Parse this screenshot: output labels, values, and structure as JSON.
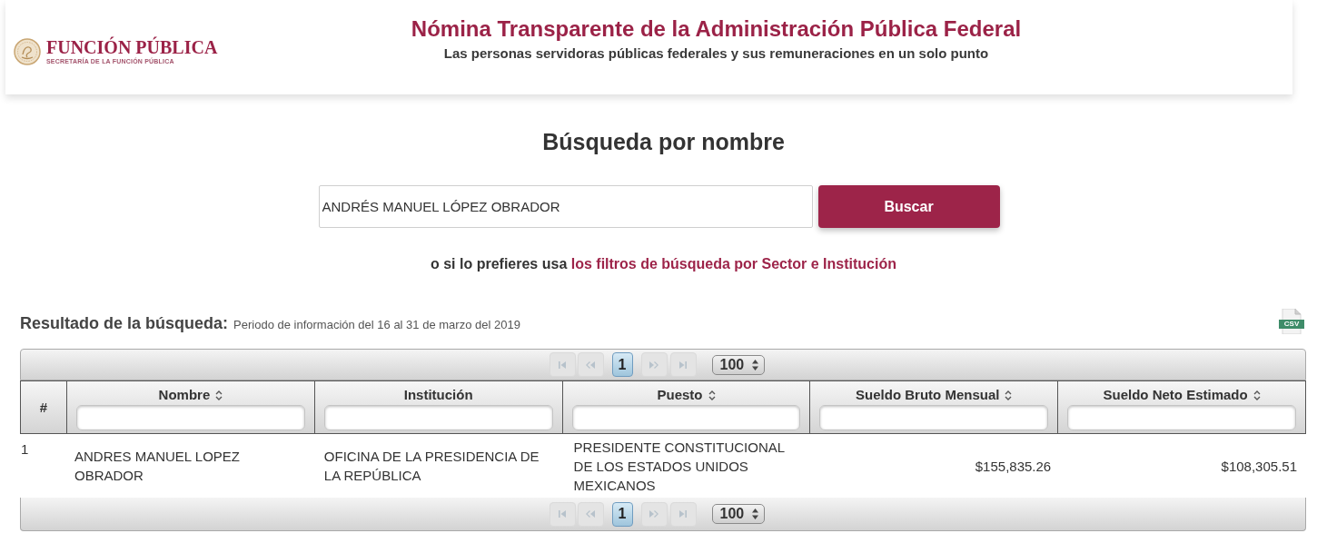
{
  "header": {
    "logo_name": "FUNCIÓN PÚBLICA",
    "logo_tagline": "SECRETARÍA DE LA FUNCIÓN PÚBLICA",
    "title": "Nómina Transparente de la Administración Pública Federal",
    "subtitle": "Las personas servidoras públicas federales y sus remuneraciones en un solo punto"
  },
  "search": {
    "heading": "Búsqueda por nombre",
    "value": "ANDRÉS MANUEL LÓPEZ OBRADOR",
    "button": "Buscar",
    "hint": "o si lo prefieres usa",
    "hint_link": "los filtros de búsqueda por Sector e Institución"
  },
  "results": {
    "title": "Resultado de la búsqueda:",
    "period": "Periodo de información del 16 al 31 de marzo del 2019",
    "export_label": "CSV",
    "top_pager": {
      "nav": [
        {
          "kind": "first",
          "disabled": true
        },
        {
          "kind": "prev",
          "disabled": true
        },
        {
          "kind": "next",
          "disabled": true
        },
        {
          "kind": "last",
          "disabled": true
        }
      ],
      "pages": [
        {
          "label": "1",
          "selected": true
        }
      ],
      "page_size": "100"
    },
    "table": {
      "columns": [
        {
          "label": "#",
          "kind": "index",
          "sortable": false,
          "filter": false
        },
        {
          "label": "Nombre",
          "kind": "text",
          "sortable": true,
          "filter": true
        },
        {
          "label": "Institución",
          "kind": "text",
          "sortable": false,
          "filter": true
        },
        {
          "label": "Puesto",
          "kind": "text",
          "sortable": true,
          "filter": true
        },
        {
          "label": "Sueldo Bruto Mensual",
          "kind": "money",
          "sortable": true,
          "filter": true
        },
        {
          "label": "Sueldo Neto Estimado",
          "kind": "money",
          "sortable": true,
          "filter": true
        }
      ],
      "rows": [
        {
          "cells": [
            "1",
            "ANDRES MANUEL LOPEZ OBRADOR",
            "OFICINA DE LA PRESIDENCIA DE LA REPÚBLICA",
            "PRESIDENTE CONSTITUCIONAL DE LOS ESTADOS UNIDOS MEXICANOS",
            "$155,835.26",
            "$108,305.51"
          ]
        }
      ]
    },
    "bottom_pager": {
      "nav": [
        {
          "kind": "first",
          "disabled": true
        },
        {
          "kind": "prev",
          "disabled": true
        },
        {
          "kind": "next",
          "disabled": true
        },
        {
          "kind": "last",
          "disabled": true
        }
      ],
      "pages": [
        {
          "label": "1",
          "selected": true
        }
      ],
      "page_size": "100"
    }
  }
}
